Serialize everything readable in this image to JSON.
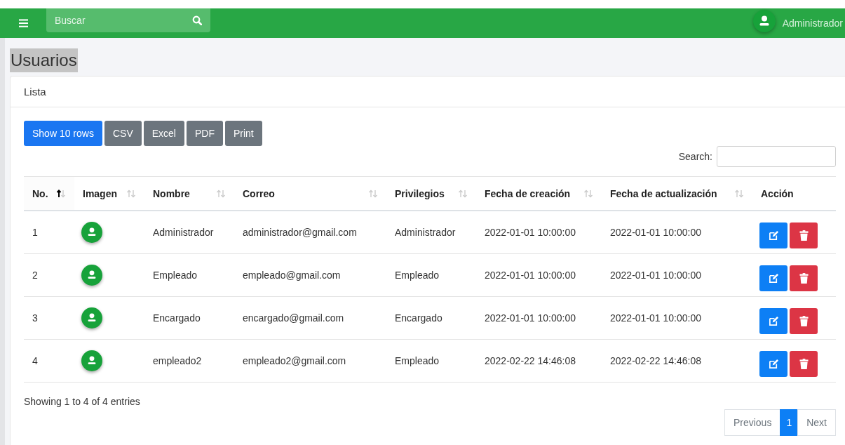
{
  "navbar": {
    "search": {
      "placeholder": "Buscar"
    },
    "user": "Administrador"
  },
  "page_title": "Usuarios",
  "card": {
    "title": "Lista",
    "buttons": [
      {
        "label": "Show 10 rows",
        "kind": "primary"
      },
      {
        "label": "CSV",
        "kind": "secondary"
      },
      {
        "label": "Excel",
        "kind": "secondary"
      },
      {
        "label": "PDF",
        "kind": "secondary"
      },
      {
        "label": "Print",
        "kind": "secondary"
      }
    ],
    "search_label": "Search:",
    "table": {
      "columns": [
        {
          "label": "No.",
          "sortable": true,
          "sorted": true
        },
        {
          "label": "Imagen",
          "sortable": true,
          "sorted": false
        },
        {
          "label": "Nombre",
          "sortable": true,
          "sorted": false
        },
        {
          "label": "Correo",
          "sortable": true,
          "sorted": false
        },
        {
          "label": "Privilegios",
          "sortable": true,
          "sorted": false
        },
        {
          "label": "Fecha de creación",
          "sortable": true,
          "sorted": false
        },
        {
          "label": "Fecha de actualización",
          "sortable": true,
          "sorted": false
        },
        {
          "label": "Acción",
          "sortable": false
        }
      ],
      "rows": [
        {
          "no": "1",
          "nombre": "Administrador",
          "correo": "administrador@gmail.com",
          "privilegios": "Administrador",
          "creado": "2022-01-01 10:00:00",
          "actualizado": "2022-01-01 10:00:00"
        },
        {
          "no": "2",
          "nombre": "Empleado",
          "correo": "empleado@gmail.com",
          "privilegios": "Empleado",
          "creado": "2022-01-01 10:00:00",
          "actualizado": "2022-01-01 10:00:00"
        },
        {
          "no": "3",
          "nombre": "Encargado",
          "correo": "encargado@gmail.com",
          "privilegios": "Encargado",
          "creado": "2022-01-01 10:00:00",
          "actualizado": "2022-01-01 10:00:00"
        },
        {
          "no": "4",
          "nombre": "empleado2",
          "correo": "empleado2@gmail.com",
          "privilegios": "Empleado",
          "creado": "2022-02-22 14:46:08",
          "actualizado": "2022-02-22 14:46:08"
        }
      ]
    },
    "info": "Showing 1 to 4 of 4 entries",
    "pagination": [
      {
        "label": "Previous",
        "selected": false
      },
      {
        "label": "1",
        "selected": true
      },
      {
        "label": "Next",
        "selected": false
      }
    ]
  }
}
